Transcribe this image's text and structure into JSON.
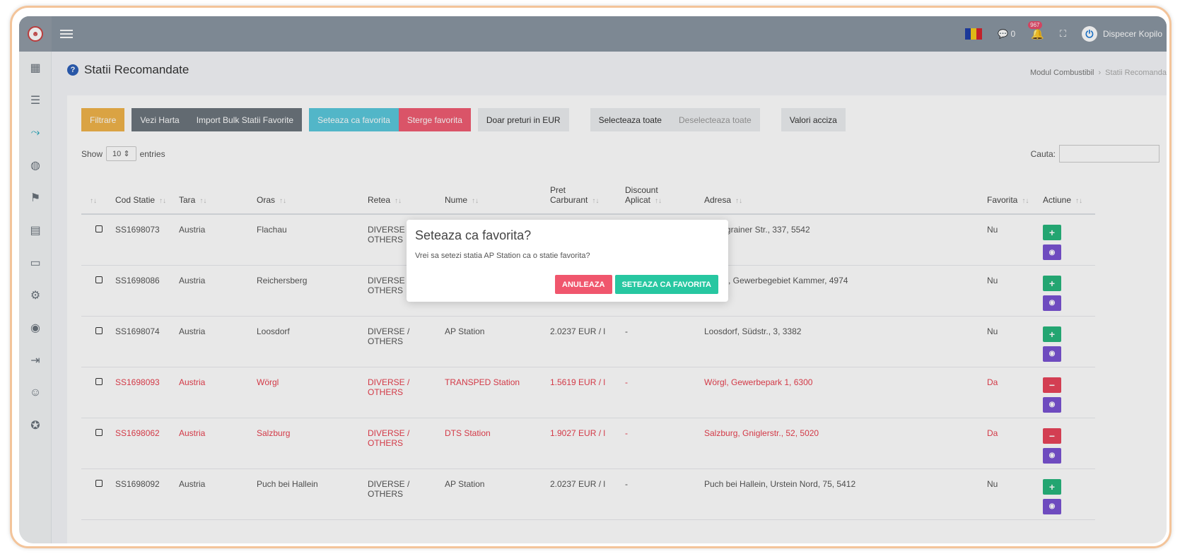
{
  "topbar": {
    "user": "Dispecer Kopilo",
    "notifications_count": "967",
    "chat_count": "0"
  },
  "page": {
    "title": "Statii Recomandate",
    "breadcrumb": [
      "Modul Combustibil",
      "Statii Recomanda"
    ]
  },
  "toolbar": {
    "filter": "Filtrare",
    "map": "Vezi Harta",
    "bulk_import": "Import Bulk Statii Favorite",
    "set_favorite": "Seteaza ca favorita",
    "delete_favorite": "Sterge favorita",
    "eur_only": "Doar preturi in EUR",
    "select_all": "Selecteaza toate",
    "deselect_all": "Deselecteaza toate",
    "excise": "Valori acciza"
  },
  "list_controls": {
    "show": "Show",
    "entries_value": "10",
    "entries": "entries",
    "search_label": "Cauta:"
  },
  "table": {
    "headers": [
      "Cod Statie",
      "Tara",
      "Oras",
      "Retea",
      "Nume",
      "Pret Carburant",
      "Discount Aplicat",
      "Adresa",
      "Favorita",
      "Actiune"
    ],
    "rows": [
      {
        "code": "SS1698073",
        "country": "Austria",
        "city": "Flachau",
        "network": "DIVERSE / OTHERS",
        "name": "",
        "price": "",
        "discount": "",
        "address": "u, Wagrainer Str., 337, 5542",
        "favorite": "Nu",
        "is_favorite": false
      },
      {
        "code": "SS1698086",
        "country": "Austria",
        "city": "Reichersberg",
        "network": "DIVERSE / OTHERS",
        "name": "",
        "price": "",
        "discount": "",
        "address": "rsberg, Gewerbegebiet Kammer, 4974",
        "favorite": "Nu",
        "is_favorite": false
      },
      {
        "code": "SS1698074",
        "country": "Austria",
        "city": "Loosdorf",
        "network": "DIVERSE / OTHERS",
        "name": "AP Station",
        "price": "2.0237 EUR / l",
        "discount": "-",
        "address": "Loosdorf, Südstr., 3, 3382",
        "favorite": "Nu",
        "is_favorite": false
      },
      {
        "code": "SS1698093",
        "country": "Austria",
        "city": "Wörgl",
        "network": "DIVERSE / OTHERS",
        "name": "TRANSPED Station",
        "price": "1.5619 EUR / l",
        "discount": "-",
        "address": "Wörgl, Gewerbepark 1, 6300",
        "favorite": "Da",
        "is_favorite": true
      },
      {
        "code": "SS1698062",
        "country": "Austria",
        "city": "Salzburg",
        "network": "DIVERSE / OTHERS",
        "name": "DTS Station",
        "price": "1.9027 EUR / l",
        "discount": "-",
        "address": "Salzburg, Gniglerstr., 52, 5020",
        "favorite": "Da",
        "is_favorite": true
      },
      {
        "code": "SS1698092",
        "country": "Austria",
        "city": "Puch bei Hallein",
        "network": "DIVERSE / OTHERS",
        "name": "AP Station",
        "price": "2.0237 EUR / l",
        "discount": "-",
        "address": "Puch bei Hallein, Urstein Nord, 75, 5412",
        "favorite": "Nu",
        "is_favorite": false
      }
    ]
  },
  "dialog": {
    "title": "Seteaza ca favorita?",
    "message": "Vrei sa setezi statia AP Station ca o statie favorita?",
    "cancel": "ANULEAZA",
    "confirm": "SETEAZA CA FAVORITA"
  },
  "colors": {
    "favorite_row": "#e8404f",
    "topbar": "#8a96a2",
    "accent": "#17a2b8"
  },
  "icons": {
    "sidebar": [
      "dashboard-icon",
      "list-icon",
      "route-icon",
      "globe-icon",
      "flag-checkered-icon",
      "file-icon",
      "chat-icon",
      "gear-icon",
      "user-circle-icon",
      "sign-in-icon",
      "masks-icon",
      "help-icon"
    ]
  }
}
